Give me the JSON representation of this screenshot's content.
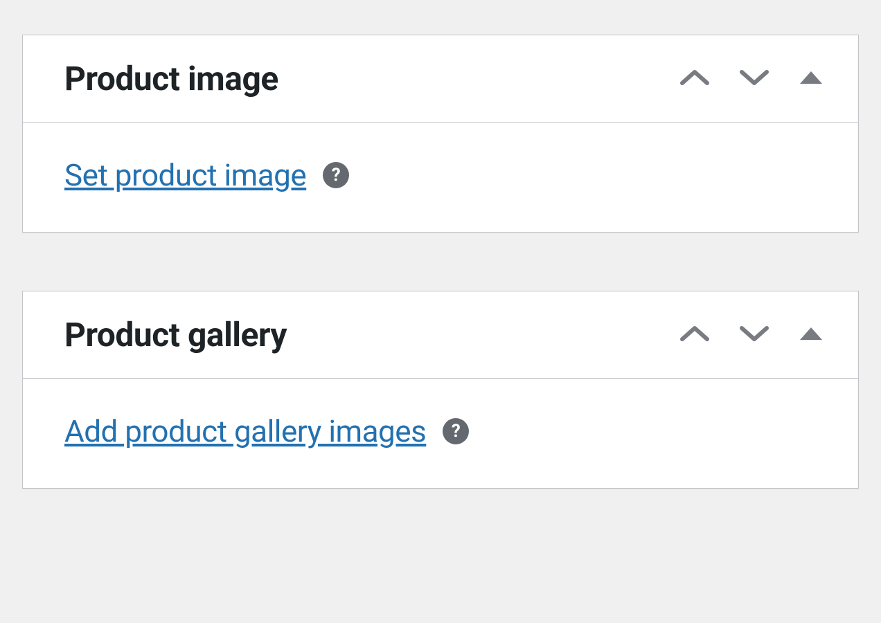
{
  "panels": [
    {
      "id": "product-image",
      "title": "Product image",
      "link_label": "Set product image"
    },
    {
      "id": "product-gallery",
      "title": "Product gallery",
      "link_label": "Add product gallery images"
    }
  ]
}
